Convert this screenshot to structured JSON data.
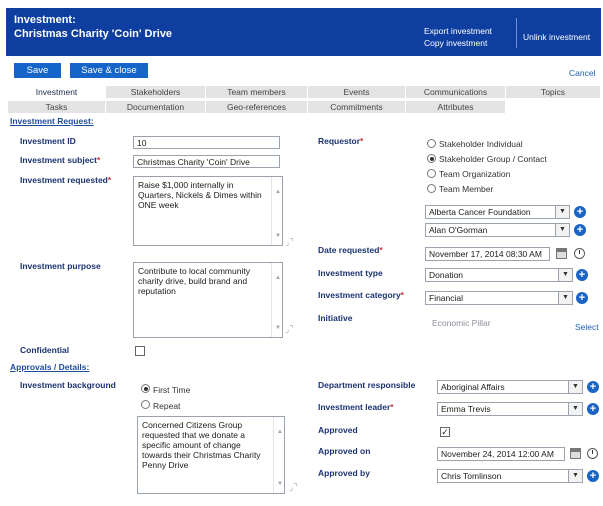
{
  "header": {
    "title_line1": "Investment:",
    "title_line2": "Christmas Charity 'Coin' Drive",
    "export_label": "Export investment",
    "copy_label": "Copy investment",
    "unlink_label": "Unlink investment"
  },
  "toolbar": {
    "save_label": "Save",
    "save_close_label": "Save & close",
    "cancel_label": "Cancel"
  },
  "tabs_row1": [
    "Investment",
    "Stakeholders",
    "Team members",
    "Events",
    "Communications",
    "Topics"
  ],
  "tabs_row2": [
    "Tasks",
    "Documentation",
    "Geo-references",
    "Commitments",
    "Attributes"
  ],
  "sections": {
    "request": "Investment Request:",
    "approvals": "Approvals / Details:"
  },
  "form": {
    "investment_id_label": "Investment ID",
    "investment_id_value": "10",
    "investment_subject_label": "Investment subject",
    "investment_subject_value": "Christmas Charity 'Coin' Drive",
    "investment_requested_label": "Investment requested",
    "investment_requested_value": "Raise $1,000 internally in Quarters, Nickels & Dimes within ONE week",
    "investment_purpose_label": "Investment purpose",
    "investment_purpose_value": "Contribute to local community charity drive, build brand and reputation",
    "confidential_label": "Confidential",
    "requestor_label": "Requestor",
    "requestor_options": [
      "Stakeholder Individual",
      "Stakeholder Group / Contact",
      "Team Organization",
      "Team Member"
    ],
    "requestor_selected": "Stakeholder Group / Contact",
    "stakeholder_group_value": "Alberta Cancer Foundation",
    "contact_value": "Alan O'Gorman",
    "date_requested_label": "Date requested",
    "date_requested_value": "November 17, 2014 08:30 AM",
    "investment_type_label": "Investment type",
    "investment_type_value": "Donation",
    "investment_category_label": "Investment category",
    "investment_category_value": "Financial",
    "initiative_label": "Initiative",
    "initiative_value": "Economic Pillar",
    "initiative_select_label": "Select",
    "background_label": "Investment background",
    "background_options": [
      "First Time",
      "Repeat"
    ],
    "background_selected": "First Time",
    "background_value": "Concerned Citizens Group requested that we donate a specific amount of change towards their Christmas Charity Penny Drive",
    "department_label": "Department responsible",
    "department_value": "Aboriginal Affairs",
    "leader_label": "Investment leader",
    "leader_value": "Emma Trevis",
    "approved_label": "Approved",
    "approved_checked": true,
    "approved_on_label": "Approved on",
    "approved_on_value": "November 24, 2014 12:00 AM",
    "approved_by_label": "Approved by",
    "approved_by_value": "Chris Tomlinson"
  },
  "icons": {
    "plus": "add-icon",
    "calendar": "calendar-icon",
    "clock": "clock-icon",
    "dropdown": "chevron-down-icon"
  },
  "colors": {
    "header_bg": "#0e3fa0",
    "primary_button": "#1565c8",
    "label_text": "#1b3272",
    "required_marker": "#d0303c"
  }
}
